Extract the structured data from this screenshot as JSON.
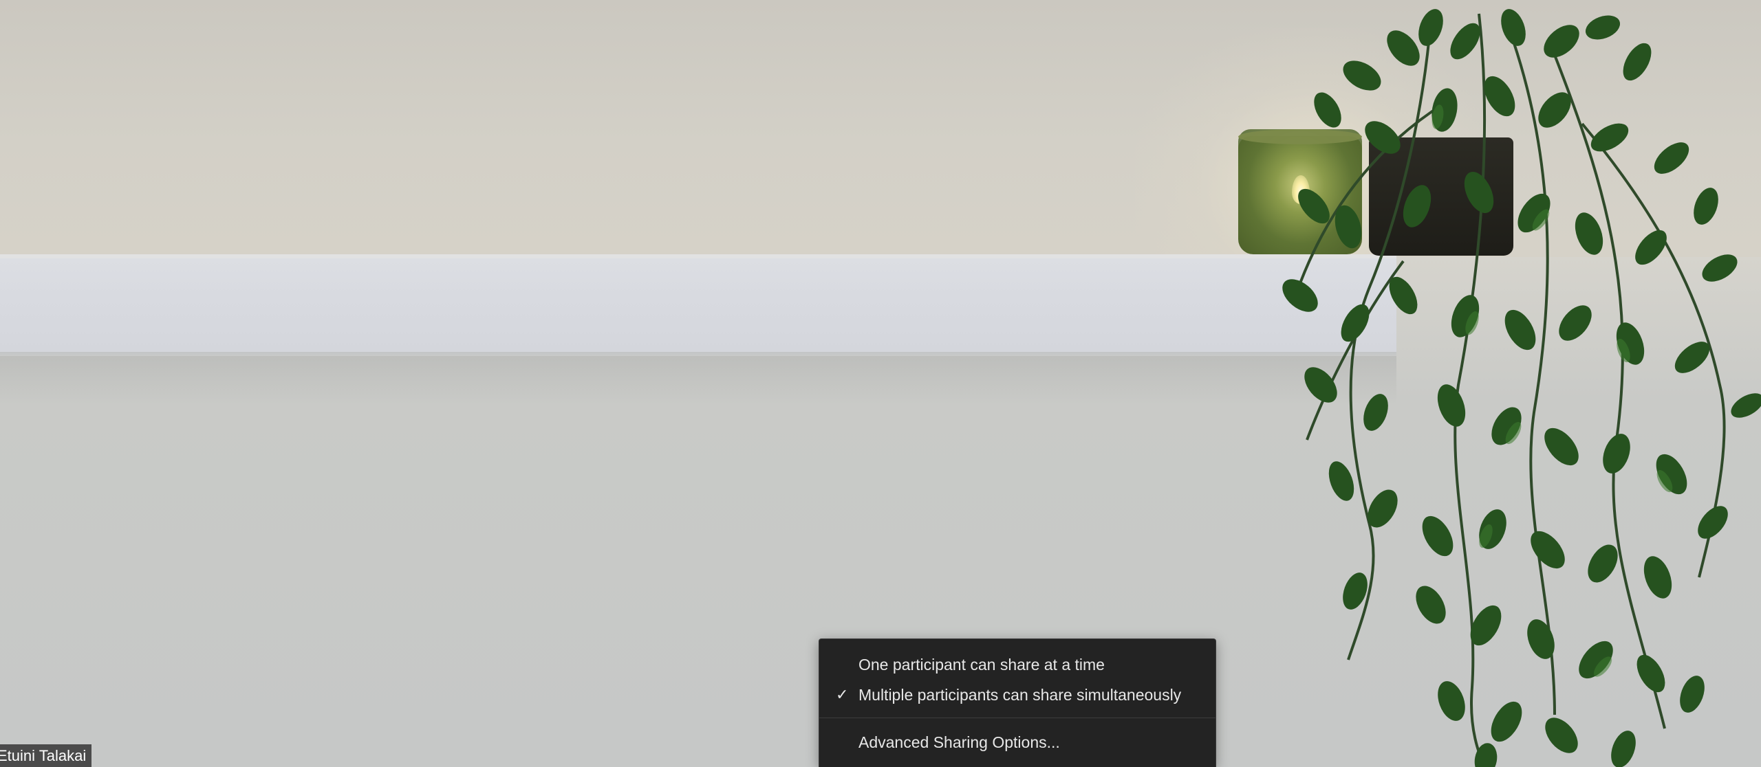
{
  "participant": {
    "name": "Etuini Talakai"
  },
  "share_menu": {
    "items": [
      {
        "label": "One participant can share at a time",
        "checked": false
      },
      {
        "label": "Multiple participants can share simultaneously",
        "checked": true
      },
      {
        "label": "Advanced Sharing Options...",
        "checked": false
      }
    ],
    "check_icon": "checkmark-icon",
    "check_glyph": "✓"
  },
  "colors": {
    "menu_background": "#232323",
    "menu_text": "#e8e8e8",
    "name_tag_background": "#282828"
  }
}
